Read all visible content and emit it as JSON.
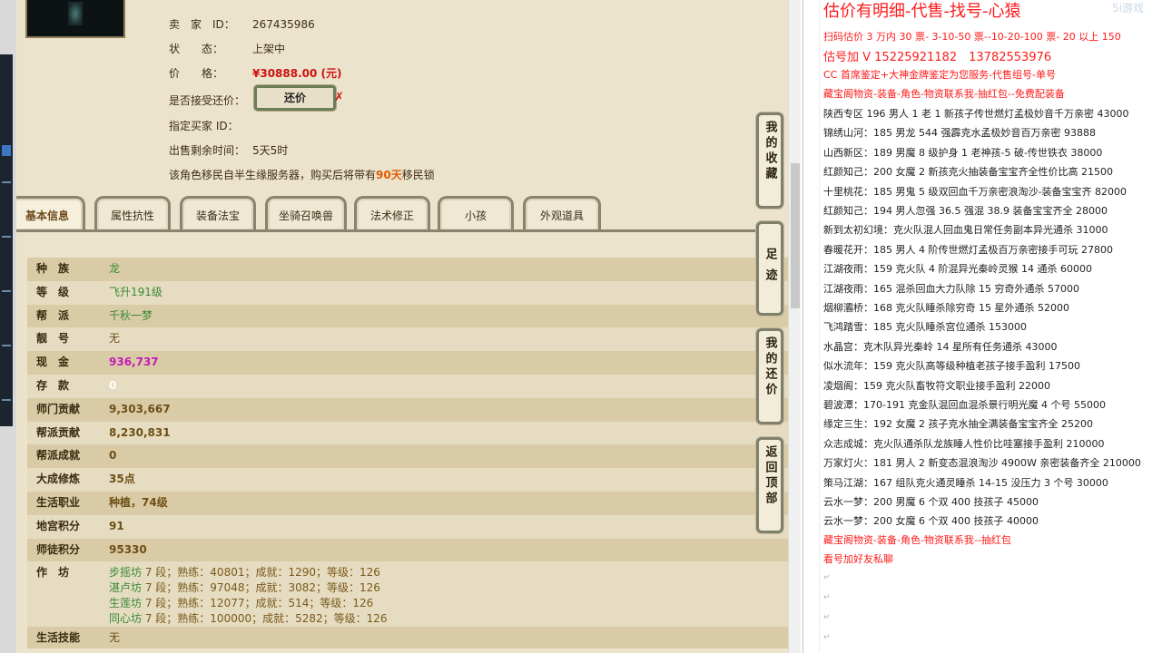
{
  "seller_info": {
    "seller_label": "卖　家　ID：",
    "seller_id": "267435986",
    "status_label": "状　　态：",
    "status": "上架中",
    "price_label": "价　　格：",
    "price": "¥30888.00 (元)",
    "counter_label": "是否接受还价：",
    "counter_button": "还价",
    "buyer_label": "指定买家 ID：",
    "time_label": "出售剩余时间：",
    "time_left": "5天5时",
    "warn_prefix": "该角色移民自半生缘服务器，购买后将带有",
    "warn_days": "90天",
    "warn_suffix": "移民锁"
  },
  "tabs": [
    "基本信息",
    "属性抗性",
    "装备法宝",
    "坐骑召唤兽",
    "法术修正",
    "小孩",
    "外观道具"
  ],
  "attributes": [
    {
      "label": "种　族",
      "value": "龙"
    },
    {
      "label": "等　级",
      "value": "飞升191级"
    },
    {
      "label": "帮　派",
      "value": "千秋一梦"
    },
    {
      "label": "靓　号",
      "value": "无"
    },
    {
      "label": "现　金",
      "value": "936,737"
    },
    {
      "label": "存　款",
      "value": "0"
    },
    {
      "label": "师门贡献",
      "value": "9,303,667"
    },
    {
      "label": "帮派贡献",
      "value": "8,230,831"
    },
    {
      "label": "帮派成就",
      "value": "0"
    },
    {
      "label": "大成修炼",
      "value": "35点"
    },
    {
      "label": "生活职业",
      "value": "种植，74级"
    },
    {
      "label": "地宫积分",
      "value": "91"
    },
    {
      "label": "师徒积分",
      "value": "95330"
    }
  ],
  "workshop": {
    "label": "作　坊",
    "items": [
      {
        "name": "步摇坊",
        "text": "7 段；熟练：40801；成就：1290；等级：126"
      },
      {
        "name": "湛卢坊",
        "text": "7 段；熟练：97048；成就：3082；等级：126"
      },
      {
        "name": "生莲坊",
        "text": "7 段；熟练：12077；成就：514；等级：126"
      },
      {
        "name": "同心坊",
        "text": "7 段；熟练：100000；成就：5282；等级：126"
      }
    ]
  },
  "life_skill": {
    "label": "生活技能",
    "value": "无"
  },
  "side_buttons": [
    "我的收藏",
    "足迹",
    "我的还价",
    "返回顶部"
  ],
  "doc": {
    "title": "估价有明细-代售-找号-心猿",
    "line1": "扫码估价 3 万内 30 票- 3-10-50 票--10-20-100 票- 20 以上 150",
    "line2": "估号加 V 15225921182　13782553976",
    "line3": "CC 首席鉴定+大神金牌鉴定为您服务-代售组号-单号",
    "line4": "藏宝阁物资-装备-角色-物资联系我-抽红包--免费配装备",
    "entries": [
      "陕西专区 196 男人 1 老 1 新孩子传世燃灯孟极妙音千万亲密 43000",
      "锦绣山河：185 男龙 544 强霹克水孟极妙音百万亲密 93888",
      "山西新区：189 男魔 8 级护身 1 老神孩-5 破-传世铁衣 38000",
      "红颜知己：200 女魔 2 新孩克火抽装备宝宝齐全性价比高 21500",
      "十里桃花：185 男鬼 5 级双回血千万亲密浪淘沙-装备宝宝齐 82000",
      "红颜知己：194 男人忽强 36.5 强混 38.9 装备宝宝齐全 28000",
      "新到太初幻境：克火队混人回血鬼日常任务副本异光通杀 31000",
      "春暖花开：185 男人 4 阶传世燃灯孟极百万亲密接手可玩 27800",
      "江湖夜雨：159 克火队 4 阶混异光秦岭灵猴 14 通杀 60000",
      "江湖夜雨：165 混杀回血大力队除 15 穷奇外通杀 57000",
      "烟柳灞桥：168 克火队睡杀除穷奇 15 星外通杀 52000",
      "飞鸿踏雪：185 克火队睡杀宫位通杀 153000",
      "水晶宫：克木队异光秦岭 14 星所有任务通杀 43000",
      "似水流年：159 克火队高等级种植老孩子接手盈利 17500",
      "凌烟阁：159 克火队畜牧符文职业接手盈利 22000",
      "碧波潭：170-191 克金队混回血混杀景行明光魔 4 个号 55000",
      "缘定三生：192 女魔 2 孩子克水抽全满装备宝宝齐全 25200",
      "众志成城：克火队通杀队龙族睡人性价比哇塞接手盈利 210000",
      "万家灯火：181 男人 2 新变态混浪淘沙 4900W 亲密装备齐全 210000",
      "策马江湖：167 组队克火通灵睡杀 14-15 没压力 3 个号 30000",
      "云水一梦：200 男魔 6 个双 400 技孩子 45000",
      "云水一梦：200 女魔 6 个双 400 技孩子 40000"
    ],
    "line_end1": "藏宝阁物资-装备-角色-物资联系我--抽红包",
    "line_end2": "看号加好友私聊",
    "watermark": "5i游戏",
    "para_mark": "↵"
  }
}
